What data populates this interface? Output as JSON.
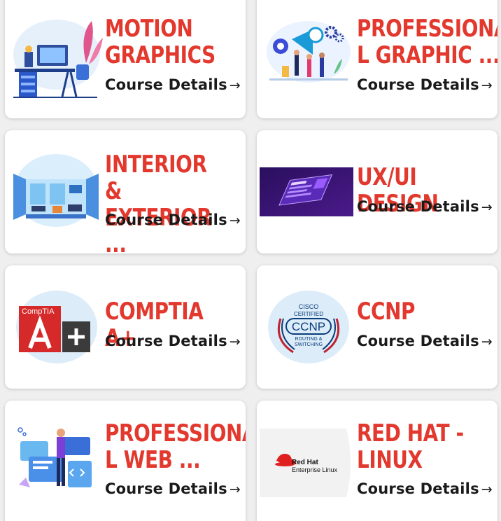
{
  "courses": [
    {
      "title": "MOTION\nGRAPHICS",
      "details": "Course Details",
      "arrow": "→",
      "thumb": "motion-graphics-illustration"
    },
    {
      "title": "PROFESSIONA\nL GRAPHIC ...",
      "details": "Course Details",
      "arrow": "→",
      "thumb": "graphic-design-team-illustration"
    },
    {
      "title": "INTERIOR &\nEXTERIOR ...",
      "details": "Course Details",
      "arrow": "→",
      "thumb": "interior-room-illustration"
    },
    {
      "title": "UX/UI DESIGN",
      "details": "Course Details",
      "arrow": "→",
      "thumb": "ux-ui-screens-photo"
    },
    {
      "title": "COMPTIA A+",
      "details": "Course Details",
      "arrow": "→",
      "thumb": "comptia-a-plus-logo",
      "logo_text": "CompTIA"
    },
    {
      "title": "CCNP",
      "details": "Course Details",
      "arrow": "→",
      "thumb": "cisco-ccnp-badge",
      "badge_top": "CISCO",
      "badge_mid": "CERTIFIED",
      "badge_main": "CCNP",
      "badge_sub1": "ROUTING &",
      "badge_sub2": "SWITCHING"
    },
    {
      "title": "PROFESSIONA\nL WEB ...",
      "details": "Course Details",
      "arrow": "→",
      "thumb": "web-development-illustration"
    },
    {
      "title": "RED HAT -\nLINUX",
      "details": "Course Details",
      "arrow": "→",
      "thumb": "red-hat-enterprise-linux-logo",
      "logo_line1": "Red Hat",
      "logo_line2": "Enterprise Linux"
    }
  ],
  "colors": {
    "title": "#e2382d",
    "text": "#1a1a1a",
    "card": "#ffffff",
    "background": "#efefef"
  }
}
